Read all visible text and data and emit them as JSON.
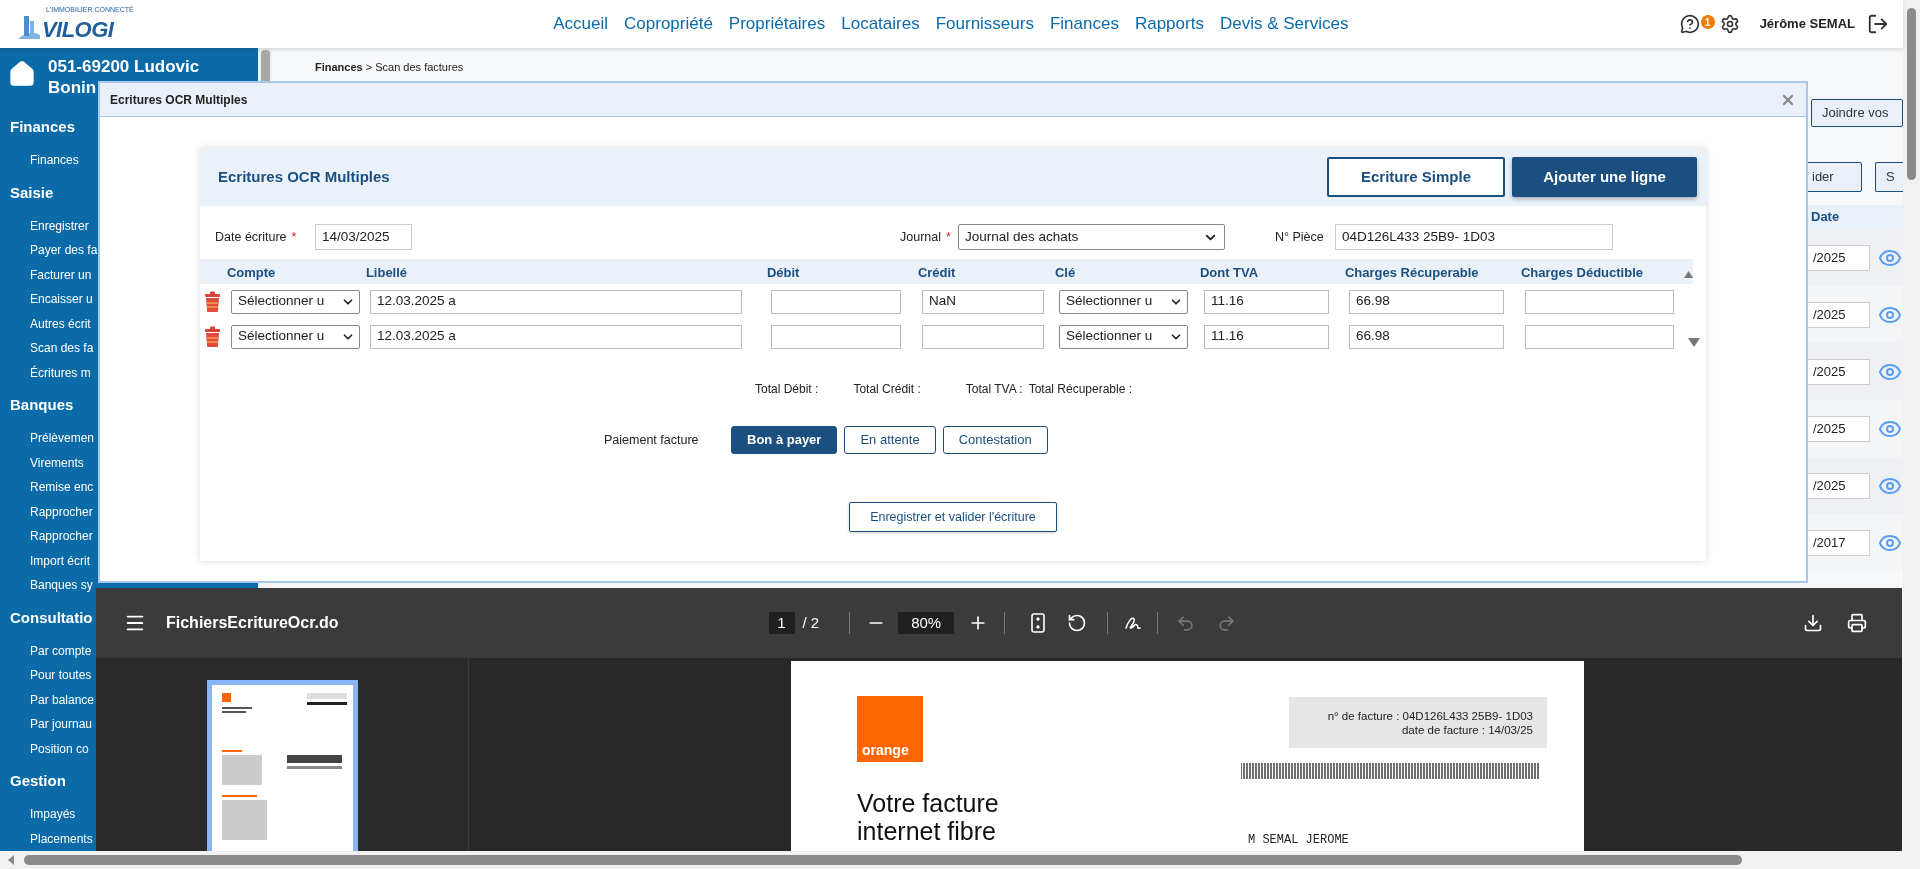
{
  "header": {
    "logo_tagline": "L'IMMOBILIER CONNECTÉ",
    "logo": "VILOGI",
    "nav": [
      "Accueil",
      "Copropriété",
      "Propriétaires",
      "Locataires",
      "Fournisseurs",
      "Finances",
      "Rapports",
      "Devis & Services"
    ],
    "notification_count": "1",
    "user": "Jérôme SEMAL"
  },
  "sidebar": {
    "title_lines": [
      "051-69200 Ludovic",
      "Bonin"
    ],
    "sections": [
      {
        "heading": "Finances",
        "items": [
          "Finances"
        ]
      },
      {
        "heading": "Saisie",
        "items": [
          "Enregistrer",
          "Payer des fa",
          "Facturer un",
          "Encaisser u",
          "Autres écrit",
          "Scan des fa",
          "Écritures m"
        ]
      },
      {
        "heading": "Banques",
        "items": [
          "Prélèvemen",
          "Virements",
          "Remise enc",
          "Rapprocher",
          "Rapprocher",
          "Import écrit",
          "Banques sy"
        ]
      },
      {
        "heading": "Consultatio",
        "items": [
          "Par compte",
          "Pour toutes",
          "Par balance",
          "Par journau",
          "Position co"
        ]
      },
      {
        "heading": "Gestion",
        "items": [
          "Impayés",
          "Placements"
        ]
      }
    ]
  },
  "breadcrumb": "**Finances** > Scan des factures",
  "background_panel": {
    "upload_button": "Joindre vos",
    "buttons": [
      "ider",
      "S"
    ],
    "date_header": "Date",
    "dates": [
      "/2025",
      "/2025",
      "/2025",
      "/2025",
      "/2025",
      "/2017"
    ]
  },
  "modal": {
    "title": "Ecritures OCR Multiples",
    "card_title": "Ecritures OCR Multiples",
    "header_buttons": [
      {
        "label": "Ecriture Simple",
        "primary": false
      },
      {
        "label": "Ajouter une ligne",
        "primary": true
      }
    ],
    "fields": [
      {
        "kind": "input",
        "label": "Date écriture",
        "required_mark": "*",
        "value": "14/03/2025"
      },
      {
        "kind": "select",
        "label": "Journal",
        "required_mark": "*",
        "value": "Journal des achats"
      },
      {
        "kind": "input",
        "label": "N° Pièce",
        "value": "04D126L433 25B9- 1D03"
      }
    ],
    "columns": [
      "Compte",
      "Libellé",
      "Débit",
      "Crédit",
      "Clé",
      "Dont TVA",
      "Charges Récuperable",
      "Charges Déductible"
    ],
    "rows": [
      {
        "compte": "Sélectionner u",
        "libelle": "12.03.2025 a",
        "credit": "NaN",
        "cle": "Sélectionner u",
        "tva": "11.16",
        "recuperable": "66.98"
      },
      {
        "compte": "Sélectionner u",
        "libelle": "12.03.2025 a",
        "cle": "Sélectionner u",
        "tva": "11.16",
        "recuperable": "66.98"
      }
    ],
    "totals": [
      "Total Débit :",
      "Total Crédit :",
      "Total TVA :",
      "Total Récuperable :"
    ],
    "payment": {
      "label": "Paiement facture",
      "options": [
        {
          "label": "Bon à payer",
          "selected": true
        },
        {
          "label": "En attente",
          "selected": false
        },
        {
          "label": "Contestation",
          "selected": false
        }
      ]
    },
    "submit": "Enregistrer et valider l'écriture"
  },
  "pdf_viewer": {
    "filename": "FichiersEcritureOcr.do",
    "page": "1",
    "page_total": "/ 2",
    "zoom": "80%",
    "history": [
      {
        "kind": "undo",
        "disabled": true
      },
      {
        "kind": "redo",
        "disabled": true
      }
    ],
    "invoice": {
      "logo": "orange",
      "number_line": "n° de facture : 04D126L433 25B9- 1D03",
      "date_line": "date de facture : 14/03/25",
      "title_lines": [
        "Votre facture",
        "internet fibre"
      ],
      "recipient": "M SEMAL JEROME"
    }
  }
}
